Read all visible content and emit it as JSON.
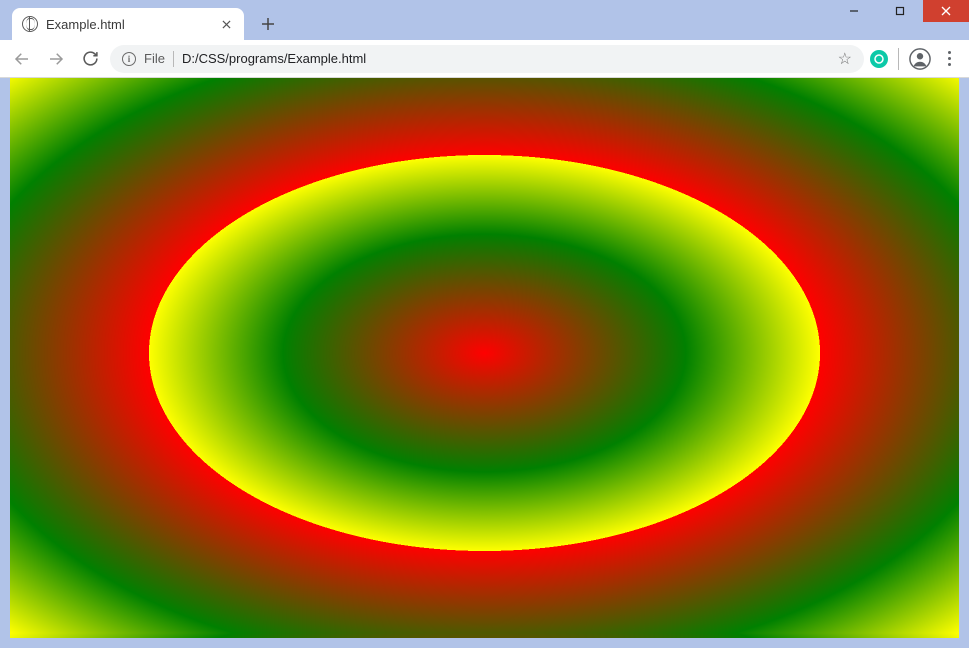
{
  "window": {
    "minimize_glyph": "—",
    "maximize_glyph": "☐",
    "close_glyph": "✕"
  },
  "tab": {
    "title": "Example.html",
    "close_glyph": "✕"
  },
  "newtab_glyph": "+",
  "omnibox": {
    "scheme_label": "File",
    "info_glyph": "i",
    "url": "D:/CSS/programs/Example.html",
    "star_glyph": "☆"
  },
  "extension": {
    "badge_letter": "G"
  },
  "page": {
    "gradient": {
      "type": "repeating-radial-gradient",
      "shape": "ellipse",
      "size": "farthest-corner",
      "position": "center",
      "stops": [
        {
          "color": "red",
          "offset": "0%"
        },
        {
          "color": "green",
          "offset": "30%"
        },
        {
          "color": "yellow",
          "offset": "50%"
        }
      ]
    }
  }
}
